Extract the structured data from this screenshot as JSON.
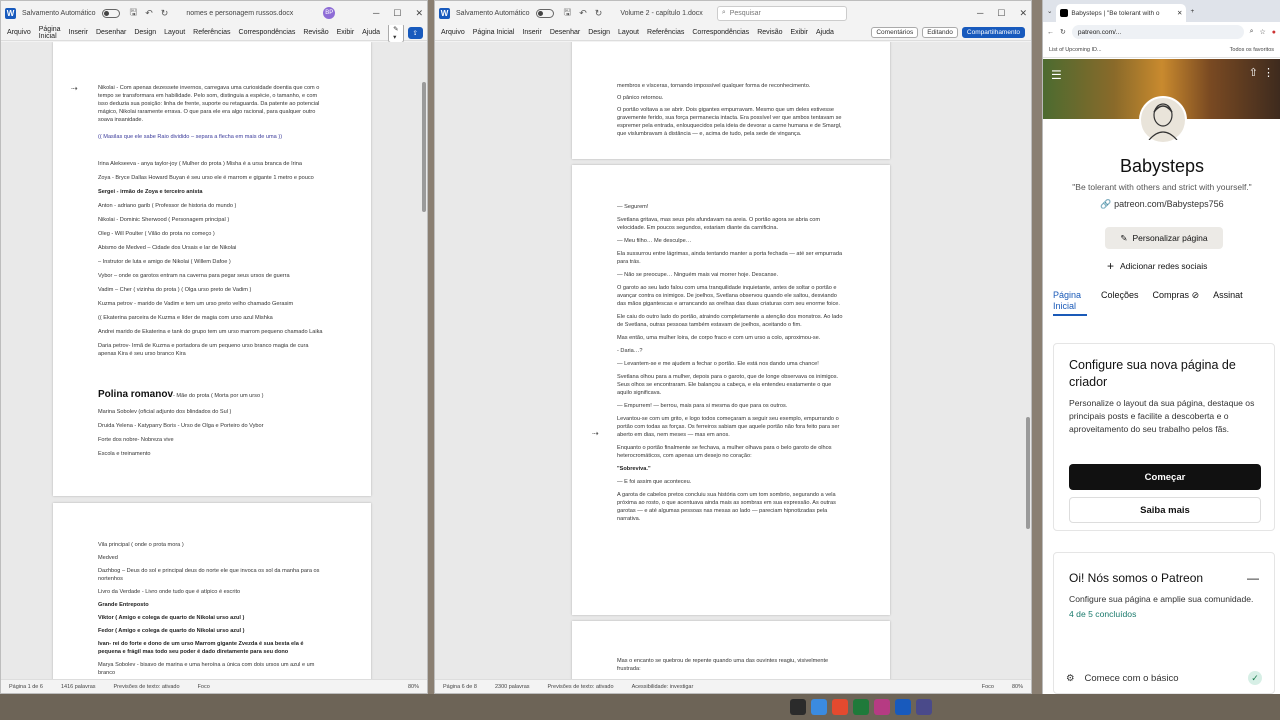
{
  "word_left": {
    "autosave_label": "Salvamento Automático",
    "doc_title": "nomes e personagem russos.docx",
    "user_initials": "BP",
    "menu": [
      "Arquivo",
      "Página Inicial",
      "Inserir",
      "Desenhar",
      "Design",
      "Layout",
      "Referências",
      "Correspondências",
      "Revisão",
      "Exibir",
      "Ajuda"
    ],
    "page1_top": "Nikolai - Com apenas dezessete invernos, carregava uma curiosidade doentia que com o tempo se transformara em habilidade. Pelo som, distinguia a espécie, o tamanho, e com isso deduzia sua posição: linha de frente, suporte ou retaguarda. Da patente ao potencial mágico, Nikolai raramente errava. O que para ele era algo racional, para qualquer outro soava insanidade.",
    "page1_top2": "(( Masilas que ele sabe Raio dividido – separa a flecha em mais de uma ))",
    "page1_lines": [
      {
        "text": "Irina Alekseeva - anya taylor-joy ( Mulher do prota ) Misha é a ursa branca de Irina",
        "bold": false
      },
      {
        "text": "Zoya - Bryce Dallas Howard Buyan é seu urso ele é marrom e gigante 1 metro e pouco",
        "bold": false
      },
      {
        "text": "Sergei - irmão de Zoya e terceiro anista",
        "bold": true
      },
      {
        "text": "Anton - adriano garib ( Professor de historia do mundo )",
        "bold": false
      },
      {
        "text": "Nikolai - Dominic Sherwood ( Personagem principal )",
        "bold": false
      },
      {
        "text": "Oleg - Will Poulter ( Vilão do prota no começo )",
        "bold": false
      },
      {
        "text": "Abismo de Medved – Cidade dos Ursais e lar de Nikolai",
        "bold": false
      },
      {
        "text": "– Instrutor de luta e amigo de Nikolai ( Willem Dafoe )",
        "bold": false
      },
      {
        "text": "Vybor – onde os garotos entram na caverna para pegar seus ursos de guerra",
        "bold": false
      },
      {
        "text": "Vadim – Cher ( vizinha do prota ) ( Olga urso preto de Vadim )",
        "bold": false
      },
      {
        "text": "Kuzma petrov - marido de Vadim e tem um urso preto velho chamado Gerasim",
        "bold": false
      },
      {
        "text": "(( Ekaterina parceira de Kuzma e líder de magia com urso azul Mishka",
        "bold": false
      },
      {
        "text": "Andrei marido de Ekaterina e tank do grupo tem um urso marrom pequeno chamado Laika",
        "bold": false
      },
      {
        "text": "Daria petrov- Irmã de Kuzma e portadora de um pequeno urso branco magia de cura apenas Kira é seu urso branco Kira",
        "bold": false
      }
    ],
    "heading": "Polina romanov",
    "heading_note": "- Mãe do prota ( Morta por um urso )",
    "page1_lines2": [
      "Marina Sobolev (oficial adjunto dos blindados do Sul )",
      "Druida Yelena - Katyparry Boris - Urso de Olga e Porteiro do Vybor",
      "Forte dos nobre- Nobreza vive",
      "Escola e treinamento"
    ],
    "page2_lines": [
      {
        "text": "Vila principal ( onde o prota mora )",
        "bold": false
      },
      {
        "text": "Medved",
        "bold": false
      },
      {
        "text": "Dazhbog – Deus do sol e principal deus do norte ele que invoca os sol da manha para os nortenhos",
        "bold": false
      },
      {
        "text": "Livro da Verdade - Livro onde tudo que é atípico é escrito",
        "bold": false
      },
      {
        "text": "Grande Entreposto",
        "bold": true
      },
      {
        "text": "Viktor ( Amigo e colega de quarto de Nikolai urso azul )",
        "bold": true
      },
      {
        "text": "Fedor ( Amigo e colega de quarto do Nikolai urso azul )",
        "bold": true
      },
      {
        "text": "Ivan- rei do forte e dono de um urso Marrom gigante Zvezda é sua besta ela é pequena e frágil mas todo seu poder é dado diretamente para seu dono",
        "bold": true
      },
      {
        "text": "Marya Sobolev - bisavo de marina e uma heroína a única com dois ursos um azul e um branco",
        "bold": false
      }
    ],
    "status": {
      "page": "Página 1 de 6",
      "words": "1416 palavras",
      "predict": "Previsões de texto: ativado",
      "focus": "Foco",
      "zoom": "80%"
    }
  },
  "word_right": {
    "autosave_label": "Salvamento Automático",
    "doc_title": "Volume 2 - capítulo 1.docx",
    "search_placeholder": "Pesquisar",
    "menu": [
      "Arquivo",
      "Página Inicial",
      "Inserir",
      "Desenhar",
      "Design",
      "Layout",
      "Referências",
      "Correspondências",
      "Revisão",
      "Exibir",
      "Ajuda"
    ],
    "comments_label": "Comentários",
    "editing_label": "Editando",
    "share_label": "Compartilhamento",
    "page_a": [
      "membros e vísceras, tornando impossível qualquer forma de reconhecimento.",
      "O pânico retornou.",
      "O portão voltava a se abrir. Dois gigantes empurravam. Mesmo que um deles estivesse gravemente ferido, sua força permanecia intacta. Era possível ver que ambos tentavam se espremer pela entrada, enlouquecidos pela ideia de devorar a carne humana e de Smargl, que vislumbravam à distância — e, acima de tudo, pela sede de vingança."
    ],
    "page_b": [
      "— Segurem!",
      "Svetlana gritava, mas seus pés afundavam na areia. O portão agora se abria com velocidade. Em poucos segundos, estariam diante da carnificina.",
      "— Meu filho… Me desculpe…",
      "Ela sussurrou entre lágrimas, ainda tentando manter a porta fechada — até ser empurrada para trás.",
      "— Não se preocupe… Ninguém mais vai morrer hoje. Descanse.",
      "O garoto ao seu lado falou com uma tranquilidade inquietante, antes de soltar o portão e avançar contra os inimigos. De joelhos, Svetlana observou quando ele saltou, desviando das mãos gigantescas e arrancando as orelhas das duas criaturas com seu enorme foice.",
      "Ele caiu do outro lado do portão, atraindo completamente a atenção dos monstros. Ao lado de Svetlana, outras pessoas também estavam de joelhos, aceitando o fim.",
      "Mas então, uma mulher loira, de corpo fraco e com um urso a colo, aproximou-se.",
      "- Daria…?",
      "— Levantem-se e me ajudem a fechar o portão. Ele está nos dando uma chance!",
      "Svetlana olhou para a mulher, depois para o garoto, que de longe observava os inimigos. Seus olhos se encontraram. Ele balançou a cabeça, e ela entendeu exatamente o que aquilo significava.",
      "— Empurrem! — berrou, mais para si mesma do que para os outros.",
      "Levantou-se com um grito, e logo todos começaram a seguir seu exemplo, empurrando o portão com todas as forças. Os ferreiros sabiam que aquele portão não fora feito para ser aberto em dias, nem meses — mas em anos.",
      "Enquanto o portão finalmente se fechava, a mulher olhava para o belo garoto de olhos heterocromáticos, com apenas um desejo no coração:",
      "\"Sobreviva.\"",
      "— E foi assim que aconteceu.",
      "A garota de cabelos pretos concluiu sua história com um tom sombrio, segurando a vela próxima ao rosto, o que acentuava ainda mais as sombras em sua expressão. As outras garotas — e até algumas pessoas nas mesas ao lado — pareciam hipnotizadas pela narrativa."
    ],
    "page_c": [
      "Mas o encanto se quebrou de repente quando uma das ouvintes reagiu, visivelmente frustrada:"
    ],
    "status": {
      "page": "Página 6 de 8",
      "words": "2300 palavras",
      "predict": "Previsões de texto: ativado",
      "access": "Acessibilidade: investigar",
      "focus": "Foco",
      "zoom": "80%"
    }
  },
  "browser": {
    "tab_title": "Babysteps | \"Be tolerant with o",
    "url": "patreon.com/...",
    "bookmark": "List of Upcoming ID...",
    "bookmark_all": "Todos os favoritos",
    "creator_name": "Babysteps",
    "tagline": "\"Be tolerant with others and strict with yourself.\"",
    "link": "patreon.com/Babysteps756",
    "customize_button": "Personalizar página",
    "add_social": "Adicionar redes sociais",
    "tabs": [
      "Página Inicial",
      "Coleções",
      "Compras",
      "Assinat"
    ],
    "setup_card": {
      "title": "Configure sua nova página de criador",
      "body": "Personalize o layout da sua página, destaque os principais posts e facilite a descoberta e o aproveitamento do seu trabalho pelos fãs.",
      "primary": "Começar",
      "secondary": "Saiba mais"
    },
    "welcome_card": {
      "title": "Oi! Nós somos o Patreon",
      "body": "Configure sua página e amplie sua comunidade.",
      "progress_text": "4 de 5 concluídos",
      "step": "Comece com o básico"
    }
  },
  "colors": {
    "word_blue": "#185abd",
    "patreon_dark": "#111111",
    "link_teal": "#1a7a6c"
  }
}
